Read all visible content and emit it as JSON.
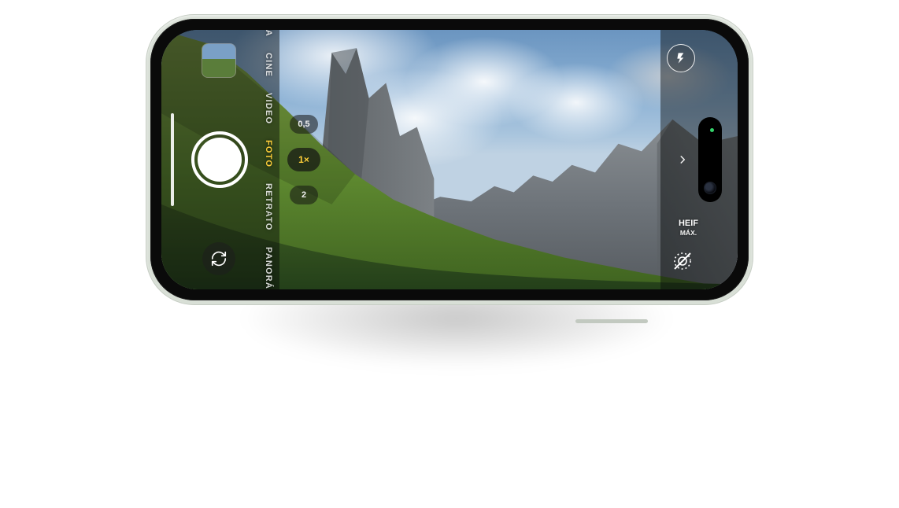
{
  "device": "iPhone (landscape) – Camera app",
  "modes": {
    "items": [
      "LENTA",
      "CINE",
      "VIDEO",
      "FOTO",
      "RETRATO",
      "PANORÁMICA"
    ],
    "active_index": 3
  },
  "zoom": {
    "options": [
      "0,5",
      "1×",
      "2"
    ],
    "active_index": 1
  },
  "format": {
    "top": "HEIF",
    "bottom": "MÁX."
  },
  "icons": {
    "flash": "flash-icon",
    "switch_camera": "switch-camera-icon",
    "expand": "chevron-right-icon",
    "live_photo_off": "live-photo-off-icon",
    "shutter": "shutter-button",
    "gallery_thumb": "gallery-thumbnail"
  },
  "colors": {
    "mode_active": "#ffcf3a",
    "zoom_active": "#ffcf3a",
    "accent_green_dot": "#34d36b"
  },
  "viewfinder_scene": "green alpine hillside with jagged dolomite peaks under partly-cloudy sky"
}
